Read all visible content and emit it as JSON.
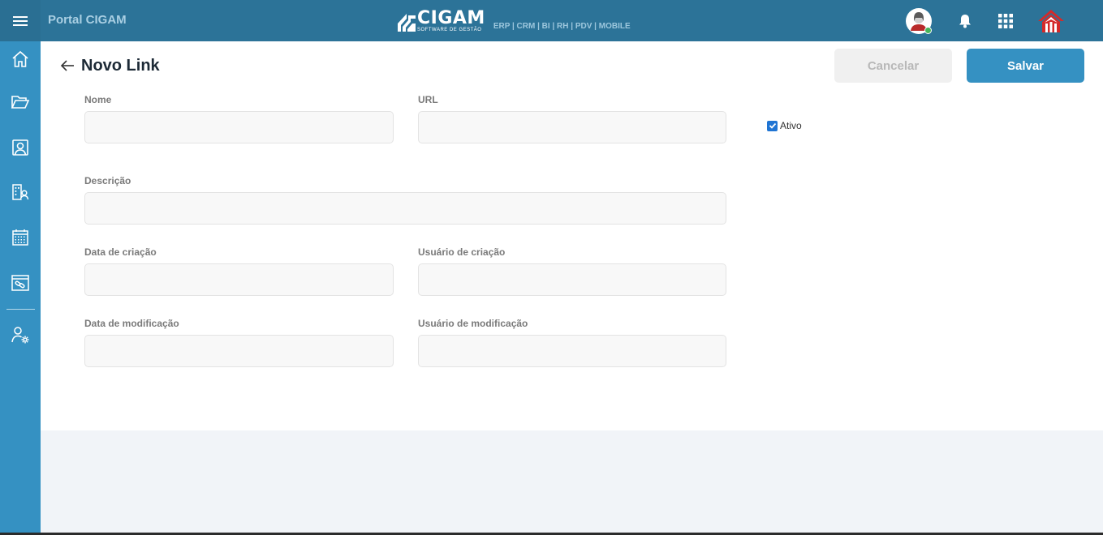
{
  "topbar": {
    "portal_title": "Portal CIGAM",
    "brand_name": "CIGAM",
    "brand_tagline": "SOFTWARE DE GESTÃO",
    "brand_modules": "ERP | CRM | BI | RH | PDV | MOBILE",
    "menu_icon": "hamburger-icon",
    "bell_icon": "bell-icon",
    "apps_icon": "grid-apps-icon",
    "user_status_color": "#46b55b"
  },
  "sidebar": {
    "items": [
      {
        "icon": "home-icon"
      },
      {
        "icon": "folder-open-icon"
      },
      {
        "icon": "contact-card-icon"
      },
      {
        "icon": "org-user-icon"
      },
      {
        "icon": "calendar-icon"
      },
      {
        "icon": "link-document-icon"
      },
      {
        "icon": "user-settings-icon"
      }
    ]
  },
  "page": {
    "title": "Novo Link",
    "cancel_label": "Cancelar",
    "save_label": "Salvar"
  },
  "form": {
    "nome_label": "Nome",
    "nome_value": "",
    "url_label": "URL",
    "url_value": "",
    "ativo_label": "Ativo",
    "ativo_checked": true,
    "descricao_label": "Descrição",
    "descricao_value": "",
    "data_criacao_label": "Data de criação",
    "data_criacao_value": "",
    "usuario_criacao_label": "Usuário de criação",
    "usuario_criacao_value": "",
    "data_modificacao_label": "Data de modificação",
    "data_modificacao_value": "",
    "usuario_modificacao_label": "Usuário de modificação",
    "usuario_modificacao_value": ""
  },
  "colors": {
    "topbar": "#2c7398",
    "sidebar": "#3591c2",
    "primary_button": "#3591c2",
    "checkbox": "#1f74d3"
  }
}
